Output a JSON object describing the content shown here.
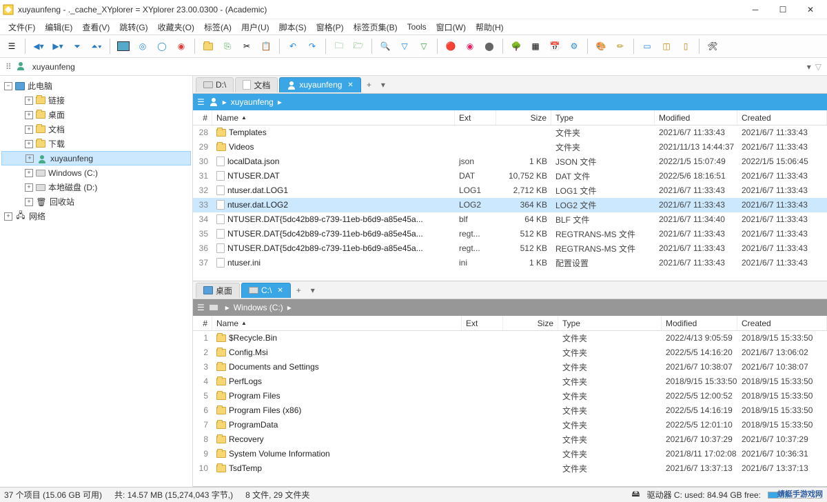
{
  "window": {
    "title": "xuyaunfeng - ._cache_XYplorer = XYplorer 23.00.0300 - (Academic)"
  },
  "menu": {
    "items": [
      "文件(F)",
      "编辑(E)",
      "查看(V)",
      "跳转(G)",
      "收藏夹(O)",
      "标签(A)",
      "用户(U)",
      "脚本(S)",
      "窗格(P)",
      "标签页集(B)",
      "Tools",
      "窗口(W)",
      "帮助(H)"
    ]
  },
  "address": {
    "path": "xuyaunfeng"
  },
  "tree": {
    "root": "此电脑",
    "nodes": [
      {
        "indent": 1,
        "label": "链接",
        "icon": "folder"
      },
      {
        "indent": 1,
        "label": "桌面",
        "icon": "folder"
      },
      {
        "indent": 1,
        "label": "文档",
        "icon": "folder"
      },
      {
        "indent": 1,
        "label": "下载",
        "icon": "folder"
      },
      {
        "indent": 1,
        "label": "xuyaunfeng",
        "icon": "user",
        "selected": true
      },
      {
        "indent": 1,
        "label": "Windows (C:)",
        "icon": "drive"
      },
      {
        "indent": 1,
        "label": "本地磁盘 (D:)",
        "icon": "drive"
      },
      {
        "indent": 1,
        "label": "回收站",
        "icon": "recycle"
      }
    ],
    "network": "网络"
  },
  "pane1": {
    "tabs": [
      {
        "label": "D:\\",
        "icon": "drive"
      },
      {
        "label": "文档",
        "icon": "doc"
      },
      {
        "label": "xuyaunfeng",
        "icon": "user",
        "active": true
      }
    ],
    "breadcrumb": [
      "xuyaunfeng"
    ],
    "headers": {
      "num": "#",
      "name": "Name",
      "ext": "Ext",
      "size": "Size",
      "type": "Type",
      "mod": "Modified",
      "cre": "Created"
    },
    "rows": [
      {
        "n": 28,
        "name": "Templates",
        "ext": "",
        "size": "",
        "type": "文件夹",
        "mod": "2021/6/7 11:33:43",
        "cre": "2021/6/7 11:33:43",
        "icon": "folder"
      },
      {
        "n": 29,
        "name": "Videos",
        "ext": "",
        "size": "",
        "type": "文件夹",
        "mod": "2021/11/13 14:44:37",
        "cre": "2021/6/7 11:33:43",
        "icon": "folder"
      },
      {
        "n": 30,
        "name": "localData.json",
        "ext": "json",
        "size": "1 KB",
        "type": "JSON 文件",
        "mod": "2022/1/5 15:07:49",
        "cre": "2022/1/5 15:06:45",
        "icon": "file"
      },
      {
        "n": 31,
        "name": "NTUSER.DAT",
        "ext": "DAT",
        "size": "10,752 KB",
        "type": "DAT 文件",
        "mod": "2022/5/6 18:16:51",
        "cre": "2021/6/7 11:33:43",
        "icon": "file"
      },
      {
        "n": 32,
        "name": "ntuser.dat.LOG1",
        "ext": "LOG1",
        "size": "2,712 KB",
        "type": "LOG1 文件",
        "mod": "2021/6/7 11:33:43",
        "cre": "2021/6/7 11:33:43",
        "icon": "file"
      },
      {
        "n": 33,
        "name": "ntuser.dat.LOG2",
        "ext": "LOG2",
        "size": "364 KB",
        "type": "LOG2 文件",
        "mod": "2021/6/7 11:33:43",
        "cre": "2021/6/7 11:33:43",
        "icon": "file",
        "sel": true
      },
      {
        "n": 34,
        "name": "NTUSER.DAT{5dc42b89-c739-11eb-b6d9-a85e45a...",
        "ext": "blf",
        "size": "64 KB",
        "type": "BLF 文件",
        "mod": "2021/6/7 11:34:40",
        "cre": "2021/6/7 11:33:43",
        "icon": "file"
      },
      {
        "n": 35,
        "name": "NTUSER.DAT{5dc42b89-c739-11eb-b6d9-a85e45a...",
        "ext": "regt...",
        "size": "512 KB",
        "type": "REGTRANS-MS 文件",
        "mod": "2021/6/7 11:33:43",
        "cre": "2021/6/7 11:33:43",
        "icon": "file"
      },
      {
        "n": 36,
        "name": "NTUSER.DAT{5dc42b89-c739-11eb-b6d9-a85e45a...",
        "ext": "regt...",
        "size": "512 KB",
        "type": "REGTRANS-MS 文件",
        "mod": "2021/6/7 11:33:43",
        "cre": "2021/6/7 11:33:43",
        "icon": "file"
      },
      {
        "n": 37,
        "name": "ntuser.ini",
        "ext": "ini",
        "size": "1 KB",
        "type": "配置设置",
        "mod": "2021/6/7 11:33:43",
        "cre": "2021/6/7 11:33:43",
        "icon": "file"
      }
    ]
  },
  "pane2": {
    "tabs": [
      {
        "label": "桌面",
        "icon": "computer"
      },
      {
        "label": "C:\\",
        "icon": "drive",
        "active": true
      }
    ],
    "breadcrumb": [
      "Windows (C:)"
    ],
    "headers": {
      "num": "#",
      "name": "Name",
      "ext": "Ext",
      "size": "Size",
      "type": "Type",
      "mod": "Modified",
      "cre": "Created"
    },
    "rows": [
      {
        "n": 1,
        "name": "$Recycle.Bin",
        "type": "文件夹",
        "mod": "2022/4/13 9:05:59",
        "cre": "2018/9/15 15:33:50",
        "icon": "folder"
      },
      {
        "n": 2,
        "name": "Config.Msi",
        "type": "文件夹",
        "mod": "2022/5/5 14:16:20",
        "cre": "2021/6/7 13:06:02",
        "icon": "folder"
      },
      {
        "n": 3,
        "name": "Documents and Settings",
        "type": "文件夹",
        "mod": "2021/6/7 10:38:07",
        "cre": "2021/6/7 10:38:07",
        "icon": "folder"
      },
      {
        "n": 4,
        "name": "PerfLogs",
        "type": "文件夹",
        "mod": "2018/9/15 15:33:50",
        "cre": "2018/9/15 15:33:50",
        "icon": "folder"
      },
      {
        "n": 5,
        "name": "Program Files",
        "type": "文件夹",
        "mod": "2022/5/5 12:00:52",
        "cre": "2018/9/15 15:33:50",
        "icon": "folder"
      },
      {
        "n": 6,
        "name": "Program Files (x86)",
        "type": "文件夹",
        "mod": "2022/5/5 14:16:19",
        "cre": "2018/9/15 15:33:50",
        "icon": "folder"
      },
      {
        "n": 7,
        "name": "ProgramData",
        "type": "文件夹",
        "mod": "2022/5/5 12:01:10",
        "cre": "2018/9/15 15:33:50",
        "icon": "folder"
      },
      {
        "n": 8,
        "name": "Recovery",
        "type": "文件夹",
        "mod": "2021/6/7 10:37:29",
        "cre": "2021/6/7 10:37:29",
        "icon": "folder"
      },
      {
        "n": 9,
        "name": "System Volume Information",
        "type": "文件夹",
        "mod": "2021/8/11 17:02:08",
        "cre": "2021/6/7 10:36:31",
        "icon": "folder"
      },
      {
        "n": 10,
        "name": "TsdTemp",
        "type": "文件夹",
        "mod": "2021/6/7 13:37:13",
        "cre": "2021/6/7 13:37:13",
        "icon": "folder"
      }
    ]
  },
  "status": {
    "left": "37 个项目 (15.06 GB 可用)",
    "mid1": "共: 14.57 MB (15,274,043 字节,)",
    "mid2": "8 文件, 29 文件夹",
    "drive": "驱动器 C:  used: 84.94 GB   free:"
  },
  "watermark": "蜻蜓手游戏网"
}
